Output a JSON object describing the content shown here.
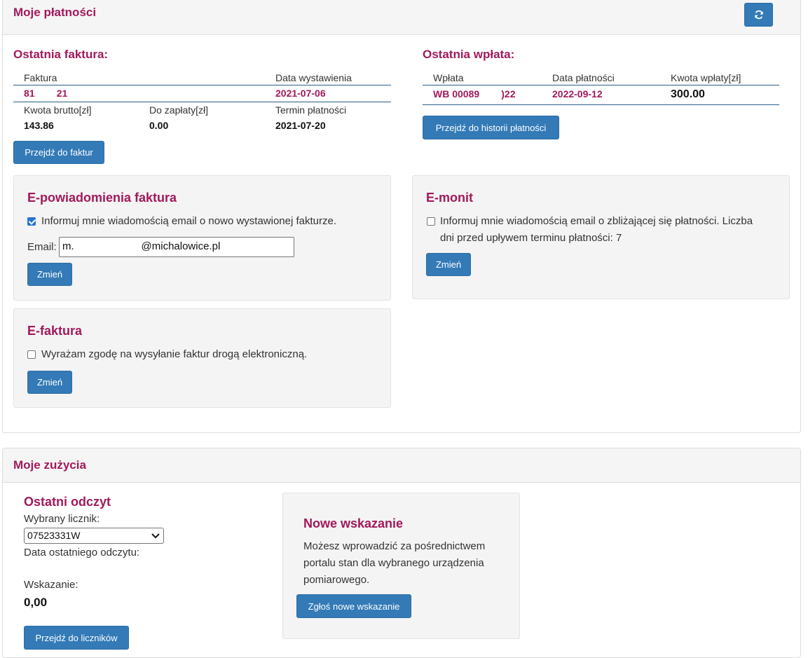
{
  "payments": {
    "title": "Moje płatności",
    "refresh_icon": "refresh-icon",
    "last_invoice": {
      "heading": "Ostatnia faktura:",
      "col_invoice": "Faktura",
      "col_issue_date": "Data wystawienia",
      "invoice_number": "81        21",
      "issue_date": "2021-07-06",
      "col_gross": "Kwota brutto[zł]",
      "col_to_pay": "Do zapłaty[zł]",
      "col_due_date": "Termin płatności",
      "gross": "143.86",
      "to_pay": "0.00",
      "due_date": "2021-07-20",
      "button": "Przejdź do faktur"
    },
    "last_payment": {
      "heading": "Ostatnia wpłata:",
      "col_payment": "Wpłata",
      "col_payment_date": "Data płatności",
      "col_amount": "Kwota wpłaty[zł]",
      "payment_number": "WB 00089        )22",
      "payment_date": "2022-09-12",
      "amount": "300.00",
      "button": "Przejdź do historii płatności"
    },
    "e_notify": {
      "heading": "E-powiadomienia faktura",
      "checkbox_label": "Informuj mnie wiadomością email o nowo wystawionej fakturze.",
      "checked": true,
      "email_label": "Email:",
      "email_value": "m.                       @michalowice.pl",
      "button": "Zmień"
    },
    "e_reminder": {
      "heading": "E-monit",
      "checkbox_label_line1": "Informuj mnie wiadomością email o zbliżającej się płatności. Liczba",
      "checkbox_label_line2": "dni przed upływem terminu płatności: 7",
      "checked": false,
      "button": "Zmień"
    },
    "e_invoice": {
      "heading": "E-faktura",
      "checkbox_label": "Wyrażam zgodę na wysyłanie faktur drogą elektroniczną.",
      "checked": false,
      "button": "Zmień"
    }
  },
  "usage": {
    "title": "Moje zużycia",
    "last_reading": {
      "heading": "Ostatni odczyt",
      "meter_label": "Wybrany licznik:",
      "meter_value": "07523331W",
      "last_date_label": "Data ostatniego odczytu:",
      "indication_label": "Wskazanie:",
      "indication_value": "0,00",
      "button": "Przejdź do liczników"
    },
    "new_reading": {
      "heading": "Nowe wskazanie",
      "text_line1": "Możesz wprowadzić za pośrednictwem",
      "text_line2": "portalu stan dla wybranego urządzenia",
      "text_line3": "pomiarowego.",
      "button": "Zgłoś nowe wskazanie"
    }
  },
  "colors": {
    "accent": "#a2195b",
    "button": "#337ab7",
    "panel_header": "#f5f5f5",
    "well": "#f4f4f4"
  }
}
